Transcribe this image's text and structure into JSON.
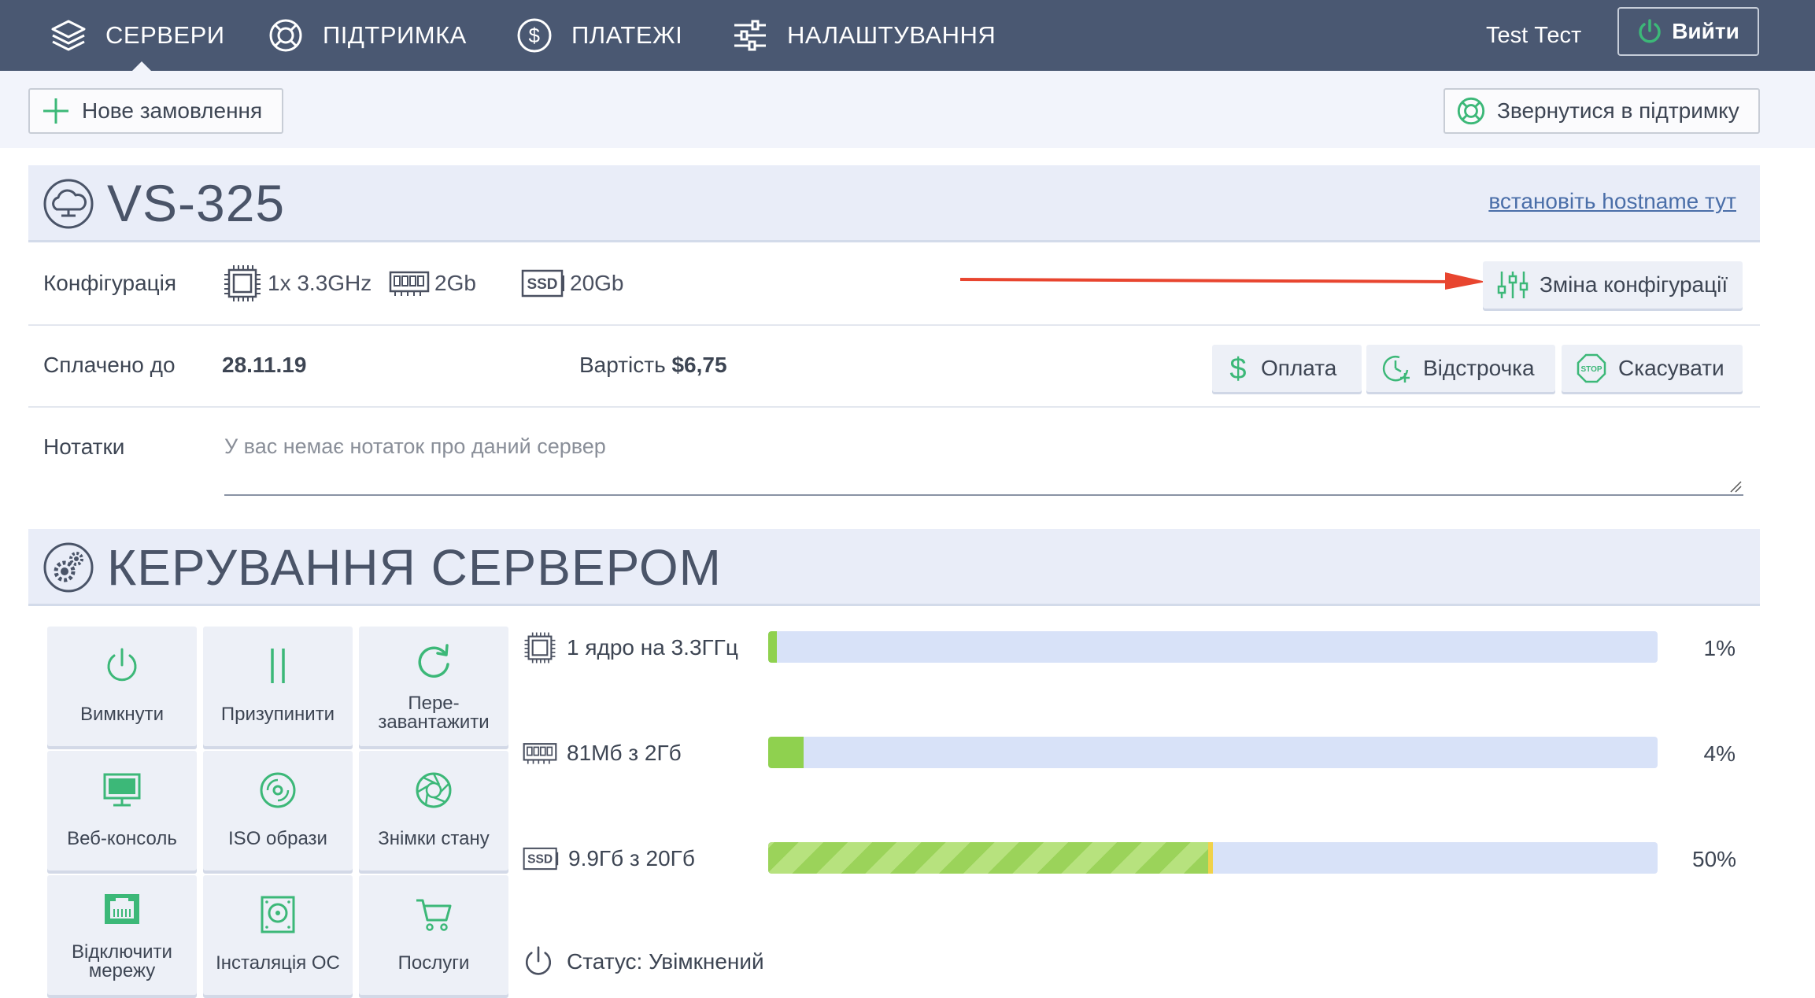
{
  "nav": {
    "items": [
      {
        "label": "СЕРВЕРИ",
        "icon": "layers-icon"
      },
      {
        "label": "ПІДТРИМКА",
        "icon": "lifebuoy-icon"
      },
      {
        "label": "ПЛАТЕЖІ",
        "icon": "dollar-coin-icon"
      },
      {
        "label": "НАЛАШТУВАННЯ",
        "icon": "sliders-icon"
      }
    ],
    "username": "Test Тест",
    "logout_label": "Вийти"
  },
  "toolbar": {
    "new_order_label": "Нове замовлення",
    "support_label": "Звернутися в підтримку"
  },
  "server": {
    "name": "VS-325",
    "hostname_link": "встановіть hostname тут"
  },
  "config": {
    "label": "Конфігурація",
    "cpu": "1x 3.3GHz",
    "ram": "2Gb",
    "disk": "20Gb",
    "disk_badge": "SSD",
    "change_label": "Зміна конфігурації"
  },
  "billing": {
    "paid_until_label": "Сплачено до",
    "paid_until_value": "28.11.19",
    "cost_label": "Вартість",
    "cost_value": "$6,75",
    "pay_label": "Оплата",
    "defer_label": "Відстрочка",
    "cancel_label": "Скасувати",
    "stop_badge": "STOP"
  },
  "notes": {
    "label": "Нотатки",
    "placeholder": "У вас немає нотаток про даний сервер"
  },
  "management": {
    "title": "КЕРУВАННЯ СЕРВЕРОМ",
    "actions": [
      {
        "label": "Вимкнути",
        "icon": "power-icon"
      },
      {
        "label": "Призупинити",
        "icon": "pause-icon"
      },
      {
        "label_line1": "Пере-",
        "label_line2": "завантажити",
        "icon": "restart-icon"
      },
      {
        "label": "Веб-консоль",
        "icon": "monitor-icon"
      },
      {
        "label": "ISO образи",
        "icon": "disc-icon"
      },
      {
        "label": "Знімки стану",
        "icon": "camera-aperture-icon"
      },
      {
        "label_line1": "Відключити",
        "label_line2": "мережу",
        "icon": "network-port-icon"
      },
      {
        "label": "Інсталяція ОС",
        "icon": "hdd-install-icon"
      },
      {
        "label": "Послуги",
        "icon": "cart-icon"
      }
    ],
    "resources": [
      {
        "label": "1 ядро на 3.3ГГц",
        "percent_label": "1%",
        "percent": 1,
        "icon": "cpu-icon"
      },
      {
        "label": "81Мб з 2Гб",
        "percent_label": "4%",
        "percent": 4,
        "icon": "ram-icon"
      },
      {
        "label": "9.9Гб з 20Гб",
        "percent_label": "50%",
        "percent": 50,
        "icon": "ssd-icon"
      }
    ],
    "status": "Статус: Увімкнений"
  },
  "colors": {
    "nav_bg": "#4a5872",
    "accent_green": "#3cb878",
    "arrow_red": "#e8452f",
    "bar_track": "#d8e2f8",
    "bar_fill": "#8fd14f"
  }
}
